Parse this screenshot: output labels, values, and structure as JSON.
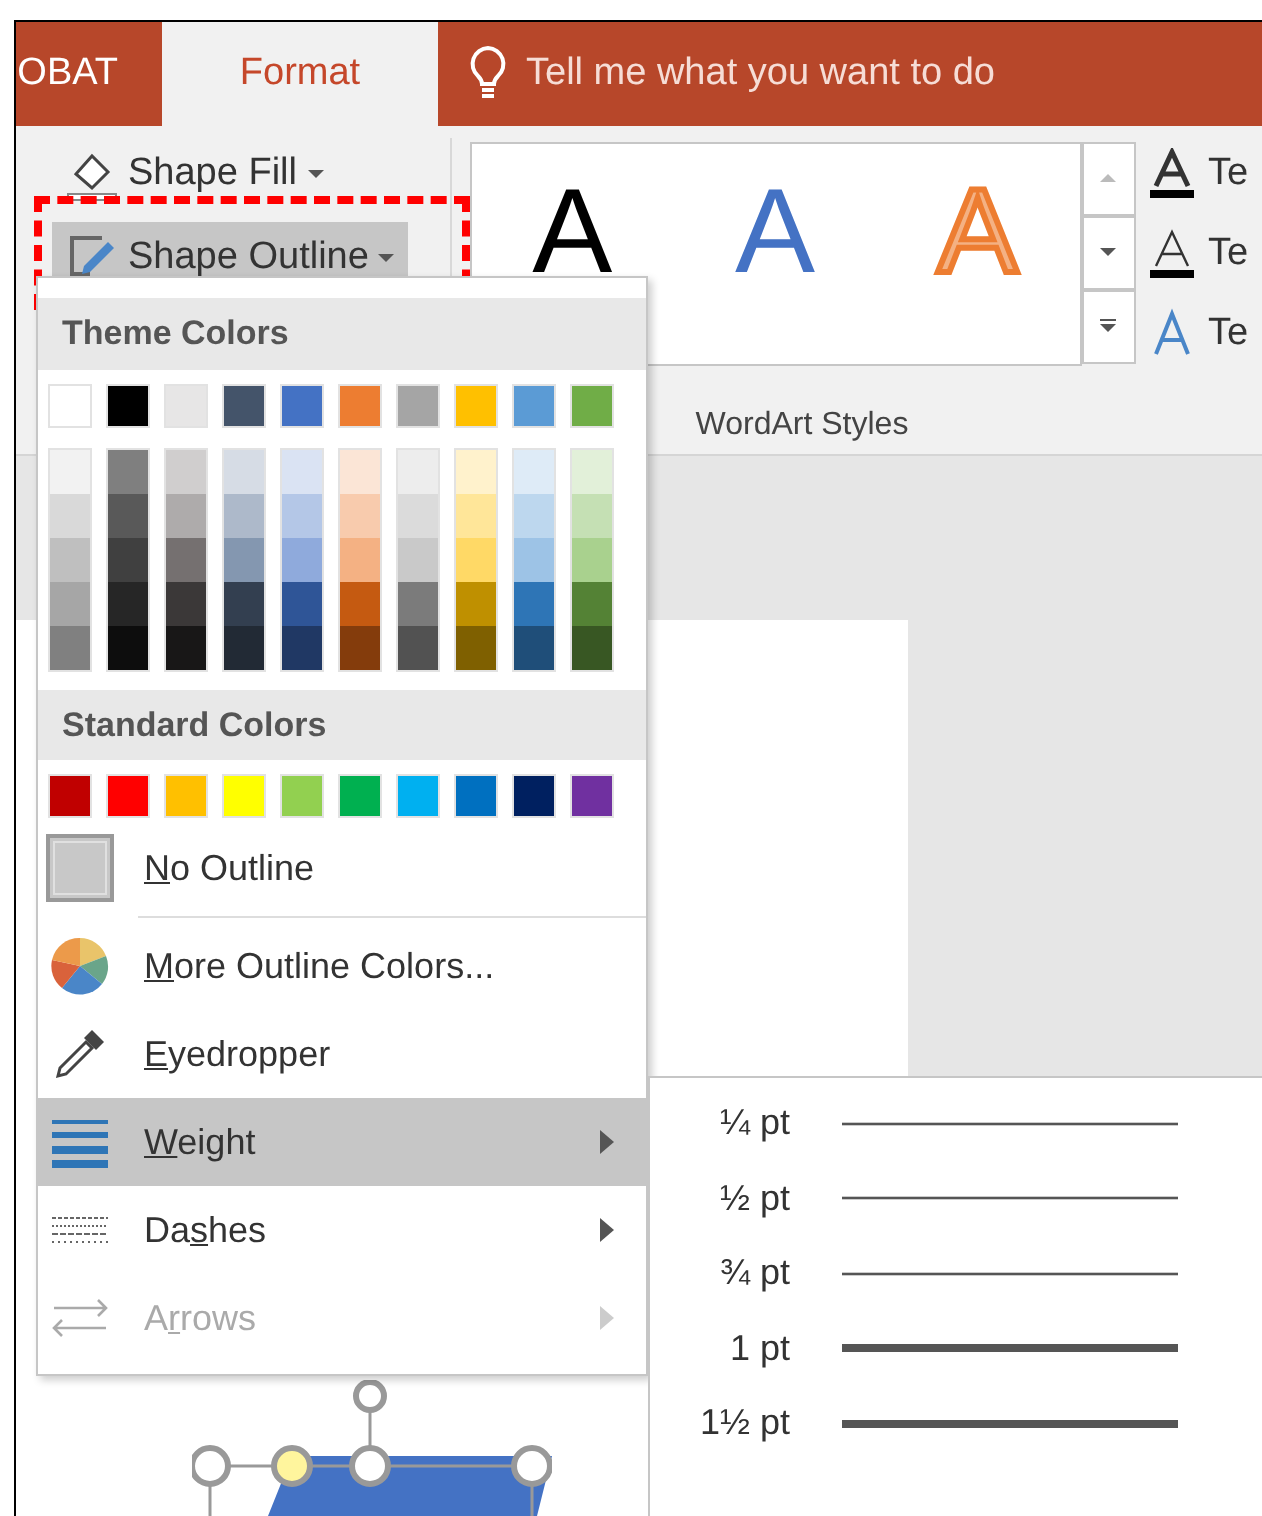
{
  "tabs": [
    {
      "label": "OBAT",
      "selected": false
    },
    {
      "label": "Format",
      "selected": true
    }
  ],
  "tell_me": {
    "placeholder": "Tell me what you want to do"
  },
  "shape_buttons": [
    {
      "label": "Shape Fill",
      "kind": "fill",
      "expanded": false
    },
    {
      "label": "Shape Outline",
      "kind": "outline",
      "expanded": true
    }
  ],
  "wordart_gallery": {
    "label": "WordArt Styles",
    "styles": [
      {
        "text": "A",
        "kind": "black"
      },
      {
        "text": "A",
        "kind": "blue"
      },
      {
        "text": "A",
        "kind": "orange"
      }
    ]
  },
  "text_options": [
    {
      "text": "Te",
      "kind": "fill"
    },
    {
      "text": "Te",
      "kind": "outline"
    },
    {
      "text": "Te",
      "kind": "effects"
    }
  ],
  "outline_menu": {
    "theme_header": "Theme Colors",
    "theme_colors": [
      {
        "color": "#ffffff",
        "shades": [
          {
            "color": "#f2f2f2"
          },
          {
            "color": "#d9d9d9"
          },
          {
            "color": "#bfbfbf"
          },
          {
            "color": "#a6a6a6"
          },
          {
            "color": "#808080"
          }
        ]
      },
      {
        "color": "#000000",
        "shades": [
          {
            "color": "#7f7f7f"
          },
          {
            "color": "#595959"
          },
          {
            "color": "#404040"
          },
          {
            "color": "#262626"
          },
          {
            "color": "#0d0d0d"
          }
        ]
      },
      {
        "color": "#e7e6e6",
        "shades": [
          {
            "color": "#d0cece"
          },
          {
            "color": "#aeabab"
          },
          {
            "color": "#757070"
          },
          {
            "color": "#3b3838"
          },
          {
            "color": "#181717"
          }
        ]
      },
      {
        "color": "#44546a",
        "shades": [
          {
            "color": "#d6dce5"
          },
          {
            "color": "#adb9ca"
          },
          {
            "color": "#8497b0"
          },
          {
            "color": "#333f50"
          },
          {
            "color": "#222a35"
          }
        ]
      },
      {
        "color": "#4472c4",
        "shades": [
          {
            "color": "#dae3f3"
          },
          {
            "color": "#b4c7e7"
          },
          {
            "color": "#8faadc"
          },
          {
            "color": "#2f5597"
          },
          {
            "color": "#203864"
          }
        ]
      },
      {
        "color": "#ed7d31",
        "shades": [
          {
            "color": "#fbe5d6"
          },
          {
            "color": "#f8cbad"
          },
          {
            "color": "#f4b183"
          },
          {
            "color": "#c55a11"
          },
          {
            "color": "#843c0c"
          }
        ]
      },
      {
        "color": "#a5a5a5",
        "shades": [
          {
            "color": "#ededed"
          },
          {
            "color": "#dbdbdb"
          },
          {
            "color": "#c9c9c9"
          },
          {
            "color": "#7b7b7b"
          },
          {
            "color": "#525252"
          }
        ]
      },
      {
        "color": "#ffc000",
        "shades": [
          {
            "color": "#fff2cc"
          },
          {
            "color": "#ffe699"
          },
          {
            "color": "#ffd966"
          },
          {
            "color": "#bf9000"
          },
          {
            "color": "#7f6000"
          }
        ]
      },
      {
        "color": "#5b9bd5",
        "shades": [
          {
            "color": "#deebf7"
          },
          {
            "color": "#bdd7ee"
          },
          {
            "color": "#9dc3e6"
          },
          {
            "color": "#2e75b6"
          },
          {
            "color": "#1f4e79"
          }
        ]
      },
      {
        "color": "#70ad47",
        "shades": [
          {
            "color": "#e2f0d9"
          },
          {
            "color": "#c5e0b4"
          },
          {
            "color": "#a9d18e"
          },
          {
            "color": "#548235"
          },
          {
            "color": "#385723"
          }
        ]
      }
    ],
    "standard_header": "Standard Colors",
    "standard_colors": [
      {
        "color": "#c00000"
      },
      {
        "color": "#ff0000"
      },
      {
        "color": "#ffc000"
      },
      {
        "color": "#ffff00"
      },
      {
        "color": "#92d050"
      },
      {
        "color": "#00b050"
      },
      {
        "color": "#00b0f0"
      },
      {
        "color": "#0070c0"
      },
      {
        "color": "#002060"
      },
      {
        "color": "#7030a0"
      }
    ],
    "items": [
      {
        "kind": "no-outline",
        "label": {
          "access_key": "N",
          "after": "o Outline"
        },
        "selected": false,
        "disabled": false,
        "has_submenu": false
      },
      {
        "kind": "more-colors",
        "label": {
          "access_key": "M",
          "after": "ore Outline Colors..."
        },
        "selected": false,
        "disabled": false,
        "has_submenu": false
      },
      {
        "kind": "eyedropper",
        "label": {
          "access_key": "E",
          "after": "yedropper"
        },
        "selected": false,
        "disabled": false,
        "has_submenu": false
      },
      {
        "kind": "weight",
        "label": {
          "access_key": "W",
          "after": "eight"
        },
        "selected": true,
        "disabled": false,
        "has_submenu": true
      },
      {
        "kind": "dashes",
        "label": {
          "before": "Da",
          "access_key": "s",
          "after": "hes"
        },
        "selected": false,
        "disabled": false,
        "has_submenu": true
      },
      {
        "kind": "arrows",
        "label": {
          "before": "A",
          "access_key": "r",
          "after": "rows"
        },
        "selected": false,
        "disabled": true,
        "has_submenu": true
      }
    ]
  },
  "weight_menu": [
    {
      "label": "¼ pt",
      "kind": "thin"
    },
    {
      "label": "½ pt",
      "kind": "thin"
    },
    {
      "label": "¾ pt",
      "kind": "thin"
    },
    {
      "label": "1 pt",
      "kind": "thick"
    },
    {
      "label": "1½ pt",
      "kind": "thick"
    }
  ]
}
